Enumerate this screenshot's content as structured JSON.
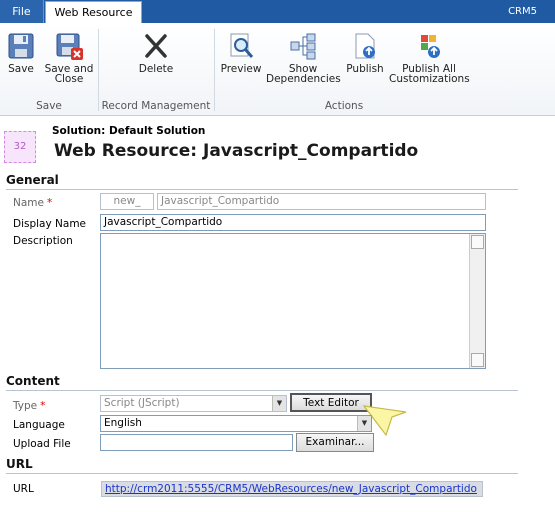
{
  "tabs": {
    "file": "File",
    "web_resource": "Web Resource"
  },
  "top_right": {
    "user": "",
    "org": "CRM5"
  },
  "ribbon": {
    "save": "Save",
    "save_and_close_1": "Save and",
    "save_and_close_2": "Close",
    "delete": "Delete",
    "preview": "Preview",
    "show_dep_1": "Show",
    "show_dep_2": "Dependencies",
    "publish": "Publish",
    "publish_all_1": "Publish All",
    "publish_all_2": "Customizations",
    "group_save": "Save",
    "group_record": "Record Management",
    "group_actions": "Actions"
  },
  "header": {
    "icon_text": "32",
    "solution": "Solution: Default Solution",
    "title": "Web Resource: Javascript_Compartido"
  },
  "general": {
    "section": "General",
    "name_label": "Name",
    "name_prefix": "new_",
    "name_value": "Javascript_Compartido",
    "display_label": "Display Name",
    "display_value": "Javascript_Compartido",
    "desc_label": "Description",
    "desc_value": ""
  },
  "content": {
    "section": "Content",
    "type_label": "Type",
    "type_value": "Script (JScript)",
    "text_editor": "Text Editor",
    "lang_label": "Language",
    "lang_value": "English",
    "upload_label": "Upload File",
    "upload_value": "",
    "browse": "Examinar..."
  },
  "url_section": {
    "section": "URL",
    "url_label": "URL",
    "url_value": "http://crm2011:5555/CRM5/WebResources/new_Javascript_Compartido"
  },
  "colors": {
    "tabbar": "#1f5aa3",
    "required": "#dd0000",
    "link": "#1a33c9"
  }
}
